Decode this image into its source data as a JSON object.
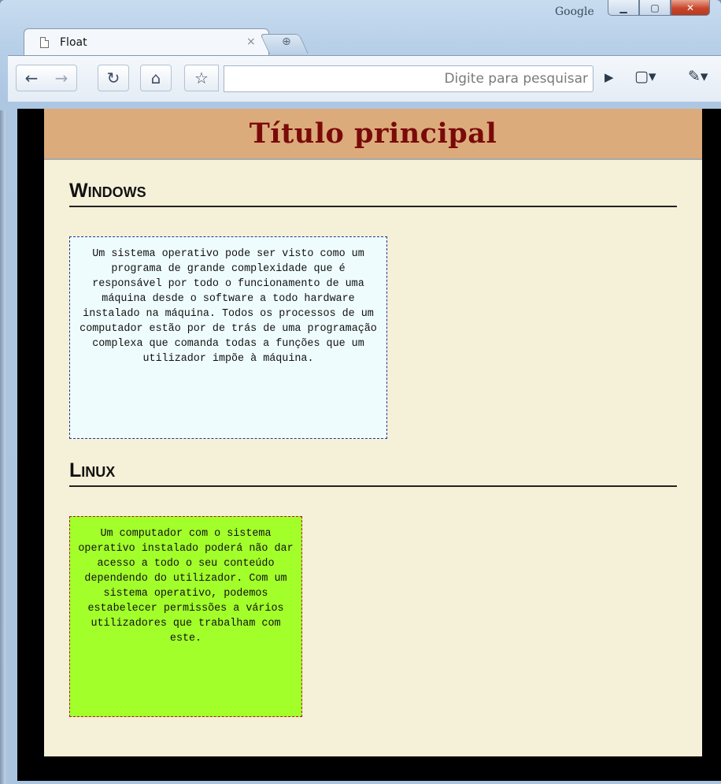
{
  "browser": {
    "brand": "Google",
    "tab_title": "Float",
    "tab_close": "×",
    "omnibox_placeholder": "Digite para pesquisar"
  },
  "page": {
    "title": "Título principal",
    "sections": [
      {
        "heading": "Windows",
        "text": "Um sistema operativo pode ser visto como um programa de grande complexidade que é responsável por todo o funcionamento de uma máquina desde o software a todo hardware instalado na máquina. Todos os processos de um computador estão por de trás de uma programação complexa que comanda todas a funções que um utilizador impõe à máquina."
      },
      {
        "heading": "Linux",
        "text": "Um computador com o sistema operativo instalado poderá não dar acesso a todo o seu conteúdo dependendo do utilizador. Com um sistema operativo, podemos estabelecer permissões a vários utilizadores que trabalham com este."
      }
    ]
  },
  "colors": {
    "header_bg": "#dcab7c",
    "title_color": "#7a0a0a",
    "page_bg": "#f5f0d8",
    "windows_box_bg": "#effcfd",
    "windows_box_border": "#27348b",
    "linux_box_bg": "#a2ff2a",
    "linux_box_border": "#b3162b"
  }
}
